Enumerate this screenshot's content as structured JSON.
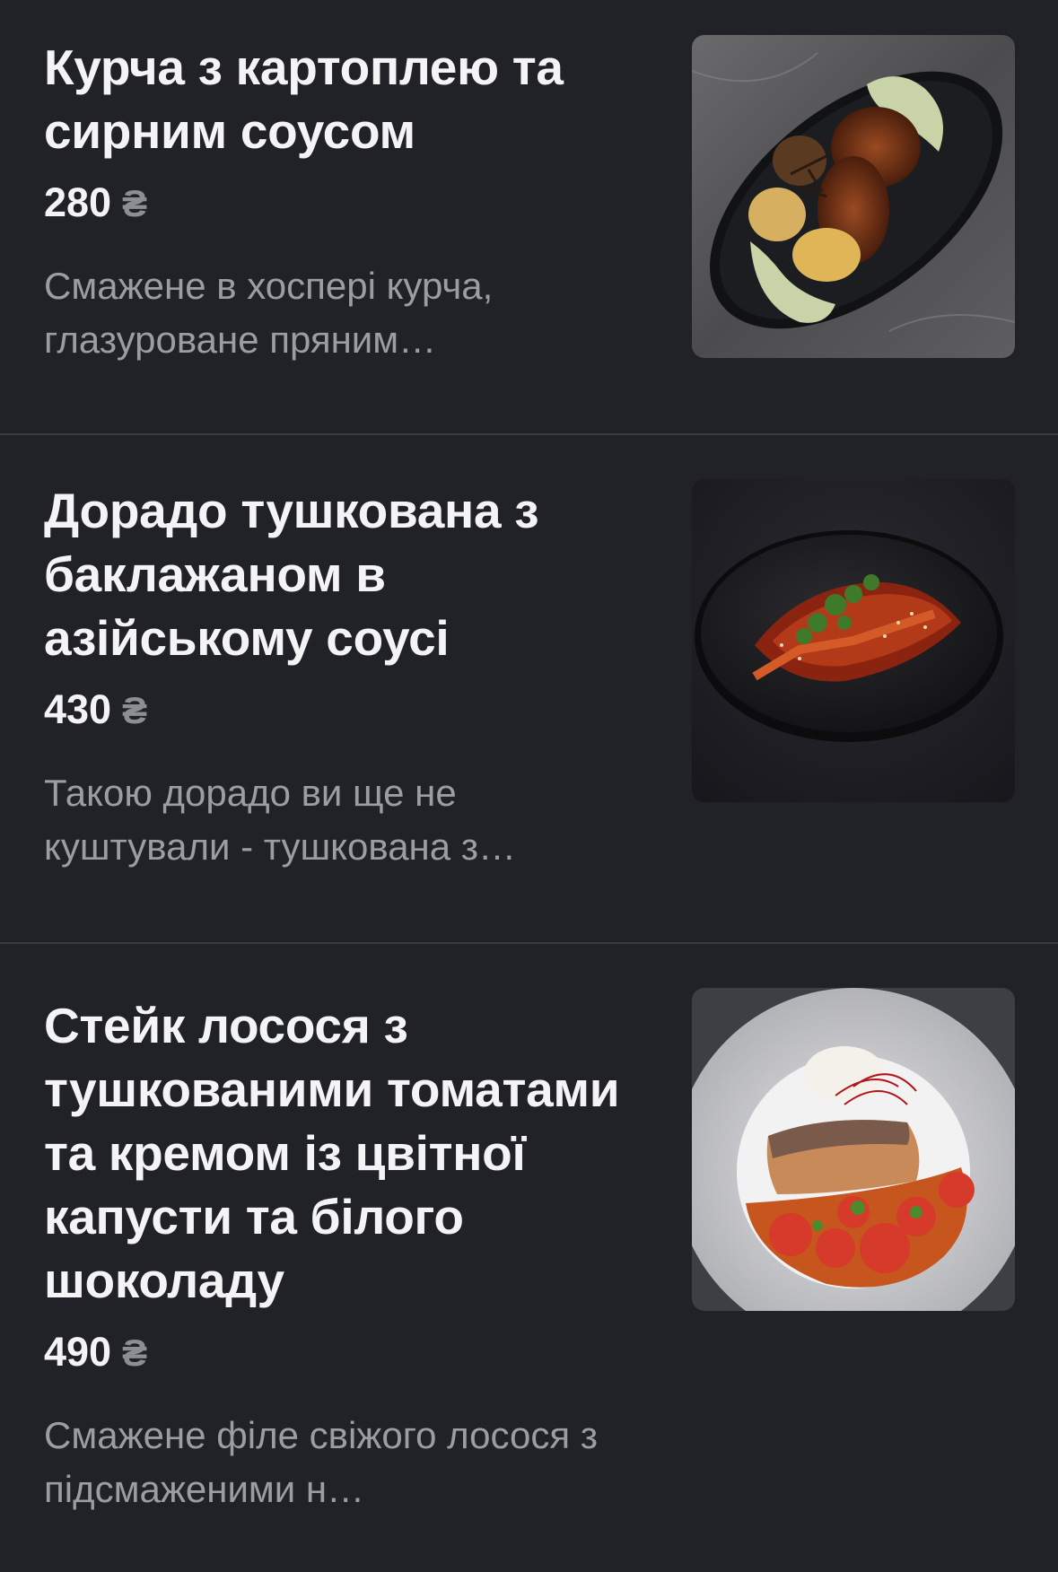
{
  "currency_symbol": "₴",
  "items": [
    {
      "name": "Курча з картоплею та сирним соусом",
      "price": "280",
      "description": "Смажене в хоспері курча, глазуроване пряним…",
      "photo_icon": "roast-chicken-dish-photo"
    },
    {
      "name": "Дорадо тушкована з баклажаном в азійському соусі",
      "price": "430",
      "description": "Такою дорадо ви ще не куштували - тушкована з…",
      "photo_icon": "dorado-eggplant-dish-photo"
    },
    {
      "name": "Стейк лосося з тушкованими томатами та кремом із цвітної капусти та білого шоколаду",
      "price": "490",
      "description": "Смажене філе свіжого лосося з підсмаженими н…",
      "photo_icon": "salmon-steak-dish-photo"
    }
  ]
}
